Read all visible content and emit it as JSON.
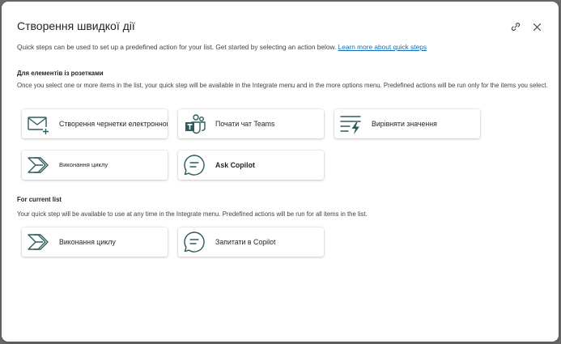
{
  "dialog": {
    "title": "Створення швидкої дії",
    "intro_text": "Quick steps can be used to set up a predefined action for your list. Get started by selecting an action below.",
    "learn_more_link": "Learn more about quick steps"
  },
  "sections": [
    {
      "title": "Для елементів із розетками",
      "description": "Once you select one or more items in the list, your quick step will be available in the Integrate menu and in the more options menu. Predefined actions will be run only for the items you select.",
      "cards": [
        {
          "label": "Створення чернетки електронного листа",
          "icon": "mail-add-icon"
        },
        {
          "label": "Почати чат Teams",
          "icon": "teams-icon"
        },
        {
          "label": "Вирівняти значення",
          "icon": "text-flash-icon"
        },
        {
          "label": "Виконання циклу",
          "icon": "power-automate-icon"
        },
        {
          "label": "Ask Copilot",
          "icon": "chat-bubble-icon"
        }
      ]
    },
    {
      "title": "For current list",
      "description": "Your quick step will be available to use at any time in the Integrate menu. Predefined actions will be run for all items in the list.",
      "cards": [
        {
          "label": "Виконання циклу",
          "icon": "power-automate-icon"
        },
        {
          "label": "Запитати в Copilot",
          "icon": "chat-bubble-icon"
        }
      ]
    }
  ],
  "colors": {
    "icon": "#2d5c5c",
    "link": "#0f6cbd"
  }
}
